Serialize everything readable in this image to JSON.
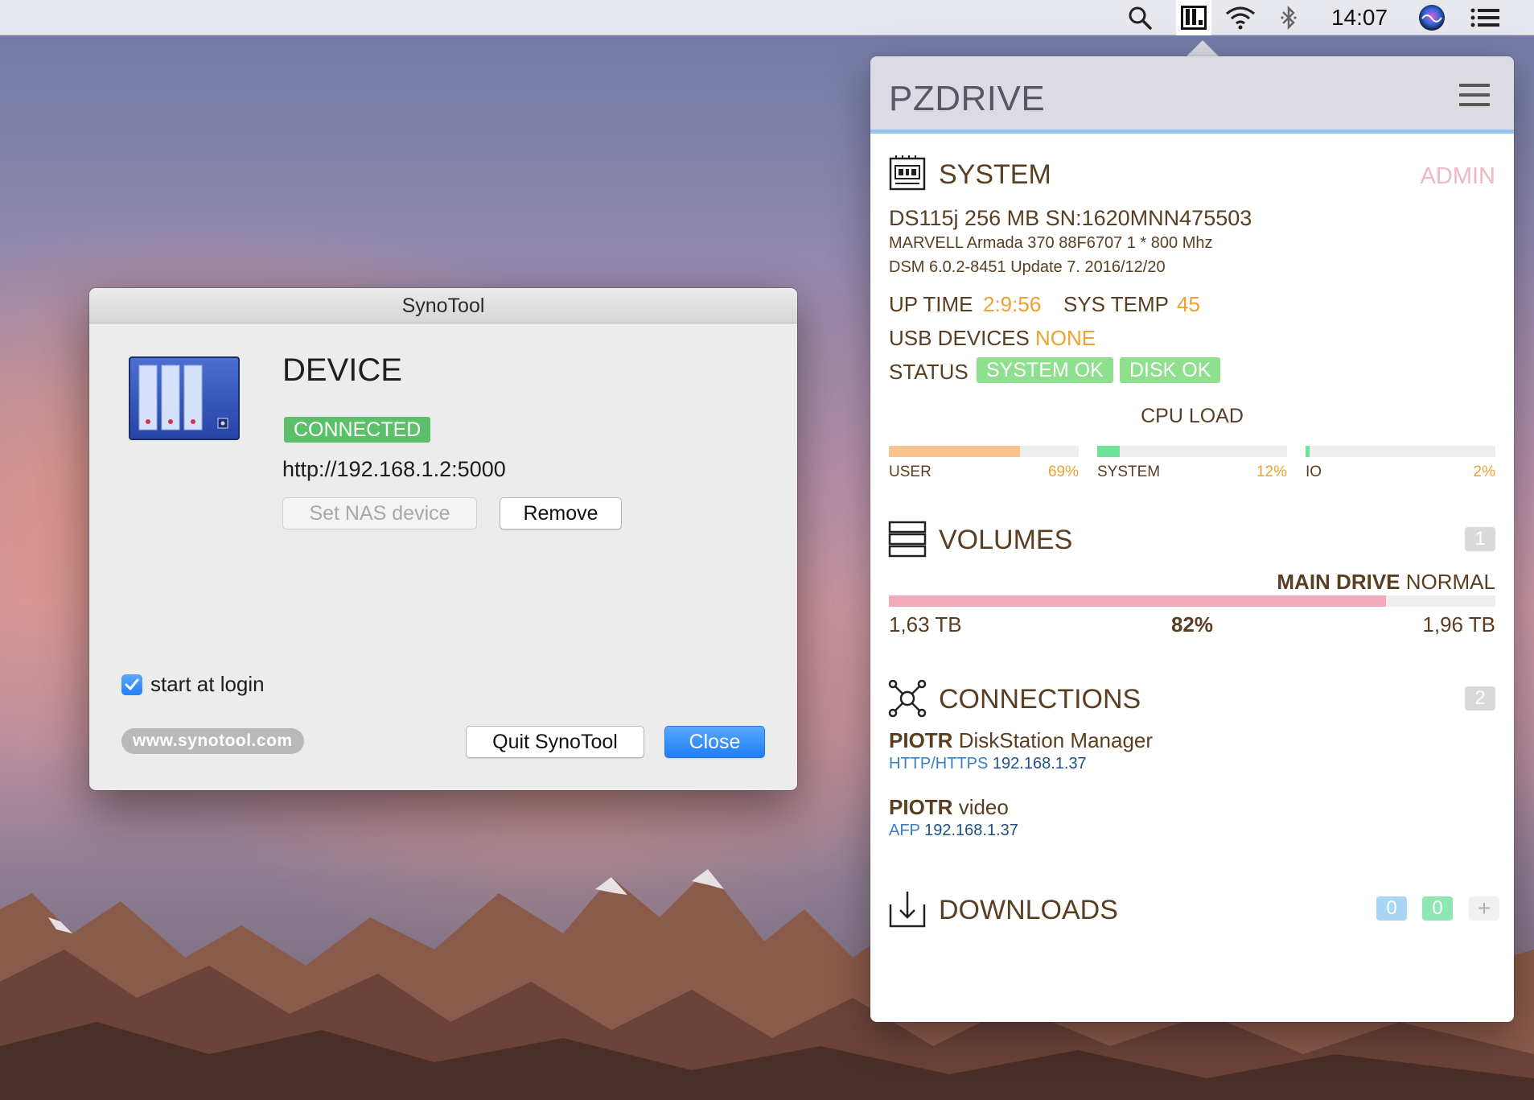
{
  "menubar": {
    "clock": "14:07",
    "icons": [
      "search-icon",
      "synotool-menubar-icon",
      "wifi-icon",
      "bluetooth-icon",
      "siri-icon",
      "notification-list-icon"
    ]
  },
  "synotool": {
    "window_title": "SynoTool",
    "device_title": "DEVICE",
    "status_badge": "CONNECTED",
    "url": "http://192.168.1.2:5000",
    "set_nas_label": "Set NAS device",
    "remove_label": "Remove",
    "start_at_login_label": "start at login",
    "start_at_login_checked": true,
    "website_label": "www.synotool.com",
    "quit_label": "Quit SynoTool",
    "close_label": "Close",
    "colors": {
      "accent": "#1d7ef5",
      "connected": "#5cbf6a"
    }
  },
  "panel": {
    "title": "PZDRIVE",
    "system": {
      "title": "SYSTEM",
      "admin_label": "ADMIN",
      "model_line": "DS115j 256 MB SN:1620MNN475503",
      "cpu_line": "MARVELL Armada 370 88F6707 1 * 800 Mhz",
      "dsm_line": "DSM 6.0.2-8451 Update 7. 2016/12/20",
      "uptime_label": "UP TIME",
      "uptime_value": "2:9:56",
      "systemp_label": "SYS TEMP",
      "systemp_value": "45",
      "usb_label": "USB DEVICES",
      "usb_value": "NONE",
      "status_label": "STATUS",
      "status_system": "SYSTEM OK",
      "status_disk": "DISK OK"
    },
    "cpu_load": {
      "title": "CPU LOAD",
      "bars": [
        {
          "label": "USER",
          "value_text": "69%",
          "fraction": 0.69,
          "color": "#f8c48d"
        },
        {
          "label": "SYSTEM",
          "value_text": "12%",
          "fraction": 0.12,
          "color": "#6ee39a"
        },
        {
          "label": "IO",
          "value_text": "2%",
          "fraction": 0.02,
          "color": "#6ee39a"
        }
      ]
    },
    "volumes": {
      "title": "VOLUMES",
      "count": "1",
      "drive_name": "MAIN DRIVE",
      "drive_status": "NORMAL",
      "used": "1,63 TB",
      "percent_text": "82%",
      "usage_fraction": 0.82,
      "total": "1,96 TB",
      "bar_color": "#f2a9b9"
    },
    "connections": {
      "title": "CONNECTIONS",
      "count": "2",
      "items": [
        {
          "user": "PIOTR",
          "app": "DiskStation Manager",
          "protocol": "HTTP/HTTPS",
          "ip": "192.168.1.37"
        },
        {
          "user": "PIOTR",
          "app": "video",
          "protocol": "AFP",
          "ip": "192.168.1.37"
        }
      ]
    },
    "downloads": {
      "title": "DOWNLOADS",
      "count_a": "0",
      "count_b": "0",
      "add_symbol": "+"
    }
  }
}
